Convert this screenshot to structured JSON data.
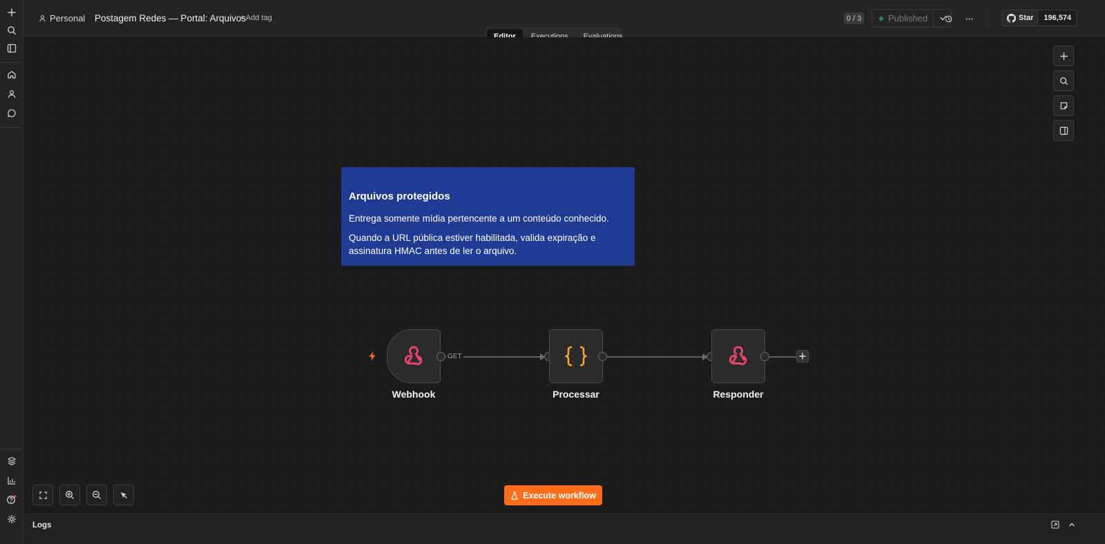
{
  "header": {
    "project": "Personal",
    "workflow_title": "Postagem Redes — Portal: Arquivos",
    "add_tag": "+ Add tag",
    "counter": "0 / 3",
    "publish_label": "Published",
    "github": {
      "star_label": "Star",
      "star_count": "196,574"
    }
  },
  "tabs": [
    {
      "label": "Editor",
      "active": true
    },
    {
      "label": "Executions",
      "active": false
    },
    {
      "label": "Evaluations",
      "active": false
    }
  ],
  "sticky_note": {
    "title": "Arquivos protegidos",
    "paragraph1": "Entrega somente mídia pertencente a um conteúdo conhecido.",
    "paragraph2": "Quando a URL pública estiver habilitada, valida expiração e assinatura HMAC antes de ler o arquivo."
  },
  "nodes": [
    {
      "label": "Webhook",
      "icon": "webhook-icon"
    },
    {
      "label": "Processar",
      "icon": "code-braces-icon"
    },
    {
      "label": "Responder",
      "icon": "webhook-icon"
    }
  ],
  "connection_label": "GET",
  "execute_button": "Execute workflow",
  "logs_label": "Logs",
  "colors": {
    "accent": "#ff6d1b",
    "sticky_bg": "#1f3b93",
    "webhook_icon": "#e8436b",
    "code_icon": "#f5a623",
    "published_dot": "#1f8a5a"
  }
}
